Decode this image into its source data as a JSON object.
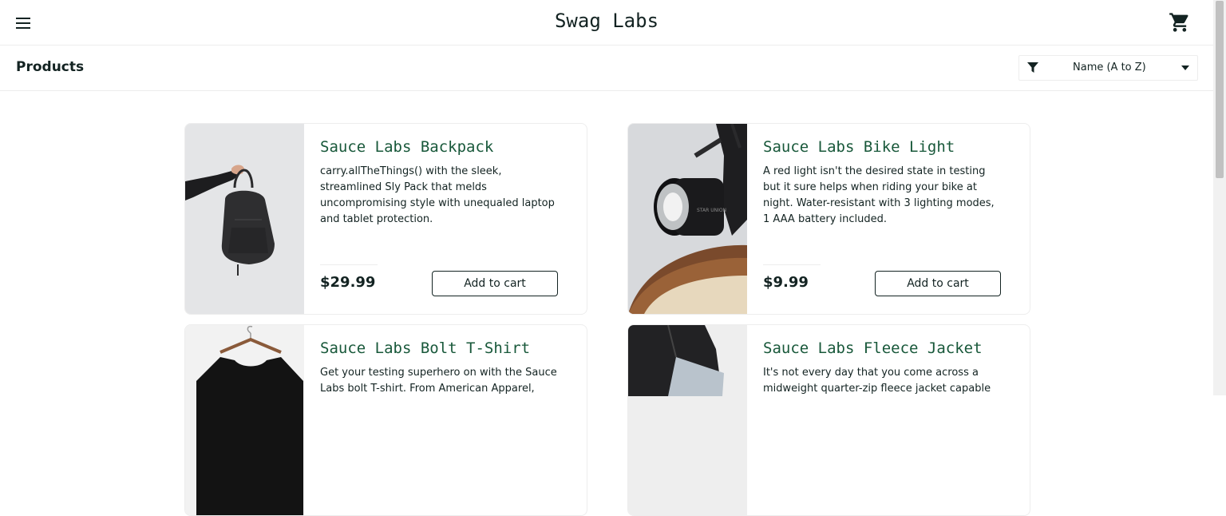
{
  "header": {
    "app_title": "Swag Labs"
  },
  "subheader": {
    "title": "Products",
    "sort_selected": "Name (A to Z)"
  },
  "products": [
    {
      "name": "Sauce Labs Backpack",
      "description": "carry.allTheThings() with the sleek, streamlined Sly Pack that melds uncompromising style with unequaled laptop and tablet protection.",
      "price": "$29.99",
      "button": "Add to cart"
    },
    {
      "name": "Sauce Labs Bike Light",
      "description": "A red light isn't the desired state in testing but it sure helps when riding your bike at night. Water-resistant with 3 lighting modes, 1 AAA battery included.",
      "price": "$9.99",
      "button": "Add to cart"
    },
    {
      "name": "Sauce Labs Bolt T-Shirt",
      "description": "Get your testing superhero on with the Sauce Labs bolt T-shirt. From American Apparel,"
    },
    {
      "name": "Sauce Labs Fleece Jacket",
      "description": "It's not every day that you come across a midweight quarter-zip fleece jacket capable"
    }
  ],
  "colors": {
    "accent": "#18583a",
    "text": "#132322",
    "border": "#ededed"
  }
}
